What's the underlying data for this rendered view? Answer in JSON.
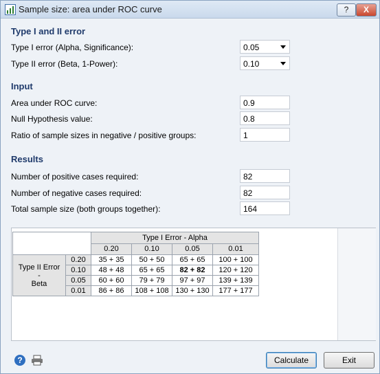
{
  "window": {
    "title": "Sample size: area under ROC curve",
    "help_button": "?",
    "close_button": "X"
  },
  "sections": {
    "type_error": "Type I and II error",
    "input": "Input",
    "results": "Results"
  },
  "type_error": {
    "alpha_label": "Type I error (Alpha, Significance):",
    "alpha_value": "0.05",
    "beta_label": "Type II error (Beta, 1-Power):",
    "beta_value": "0.10"
  },
  "input": {
    "auc_label": "Area under ROC curve:",
    "auc_value": "0.9",
    "null_label": "Null Hypothesis value:",
    "null_value": "0.8",
    "ratio_label": "Ratio of sample sizes in negative / positive groups:",
    "ratio_value": "1"
  },
  "results": {
    "pos_label": "Number of positive cases required:",
    "pos_value": "82",
    "neg_label": "Number of negative cases required:",
    "neg_value": "82",
    "total_label": "Total sample size (both groups together):",
    "total_value": "164"
  },
  "table": {
    "alpha_header": "Type I Error - Alpha",
    "beta_header_line1": "Type II Error",
    "beta_header_line2": "-",
    "beta_header_line3": "Beta",
    "alpha_cols": [
      "0.20",
      "0.10",
      "0.05",
      "0.01"
    ],
    "rows": [
      {
        "beta": "0.20",
        "cells": [
          "35 + 35",
          "50 + 50",
          "65 + 65",
          "100 + 100"
        ]
      },
      {
        "beta": "0.10",
        "cells": [
          "48 + 48",
          "65 + 65",
          "82 + 82",
          "120 + 120"
        ]
      },
      {
        "beta": "0.05",
        "cells": [
          "60 + 60",
          "79 + 79",
          "97 + 97",
          "139 + 139"
        ]
      },
      {
        "beta": "0.01",
        "cells": [
          "86 + 86",
          "108 + 108",
          "130 + 130",
          "177 + 177"
        ]
      }
    ]
  },
  "buttons": {
    "calculate": "Calculate",
    "exit": "Exit",
    "help_icon": "?"
  },
  "icons": {
    "app": "chart-icon",
    "help": "help-icon",
    "print": "printer-icon"
  }
}
